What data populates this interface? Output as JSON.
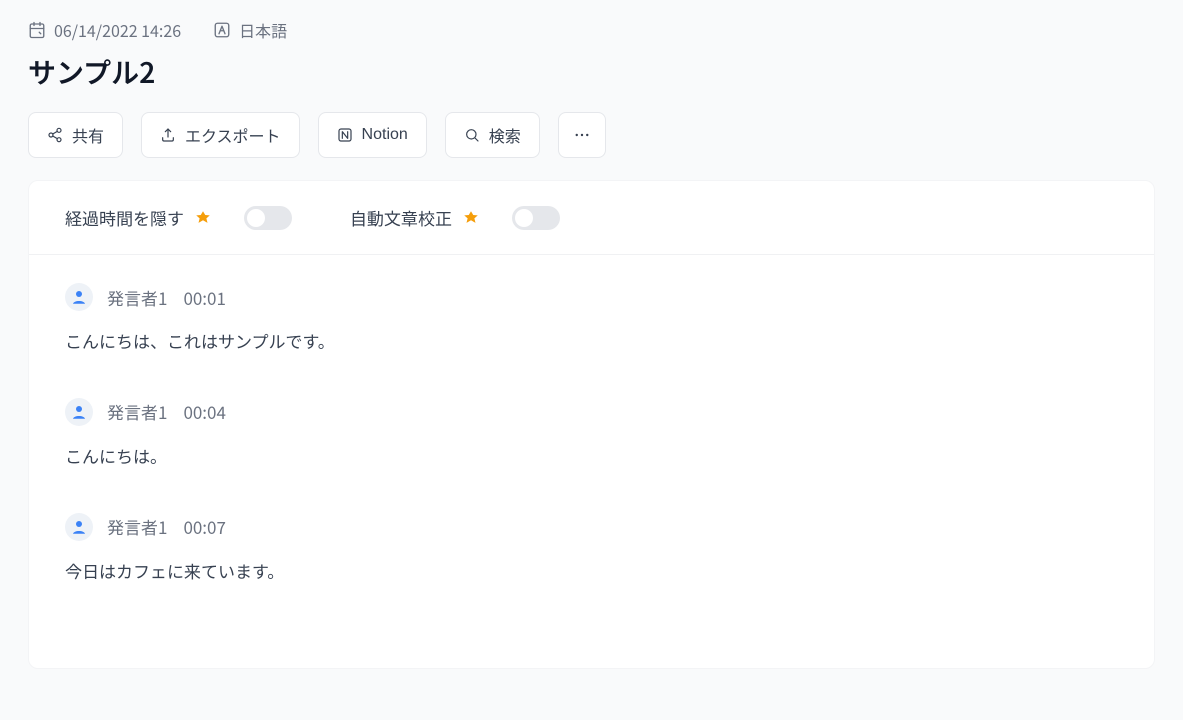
{
  "meta": {
    "datetime": "06/14/2022 14:26",
    "language": "日本語"
  },
  "title": "サンプル2",
  "toolbar": {
    "share": "共有",
    "export": "エクスポート",
    "notion": "Notion",
    "search": "検索"
  },
  "controls": {
    "hide_elapsed_label": "経過時間を隠す",
    "auto_proofread_label": "自動文章校正"
  },
  "transcript": [
    {
      "speaker": "発言者1",
      "time": "00:01",
      "text": "こんにちは、これはサンプルです。"
    },
    {
      "speaker": "発言者1",
      "time": "00:04",
      "text": "こんにちは。"
    },
    {
      "speaker": "発言者1",
      "time": "00:07",
      "text": "今日はカフェに来ています。"
    }
  ]
}
